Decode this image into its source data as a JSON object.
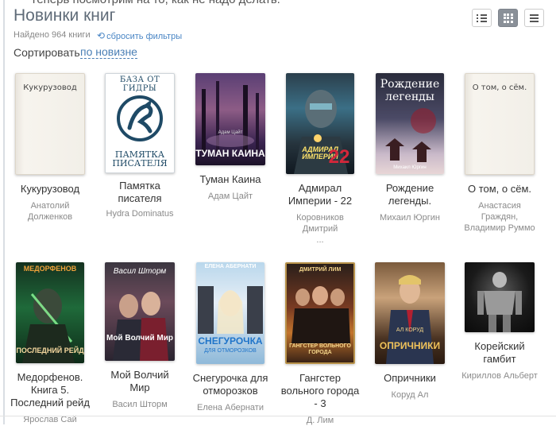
{
  "header": {
    "cut_text": "Теперь посмотрим на то, как не надо делать.",
    "title": "Новинки книг",
    "found": "Найдено 964 книги",
    "reset_filters": "сбросить фильтры",
    "sort_label": "Сортировать",
    "sort_value": "по новизне"
  },
  "view_buttons": [
    {
      "name": "list-view",
      "icon": "list-bullets-icon",
      "active": false
    },
    {
      "name": "grid-view",
      "icon": "grid-icon",
      "active": true
    },
    {
      "name": "compact-view",
      "icon": "menu-icon",
      "active": false
    }
  ],
  "books": [
    {
      "title": "Кукурузовод",
      "author": "Анатолий Долженков",
      "cover_text": "Кукурузовод"
    },
    {
      "title": "Памятка писателя",
      "author": "Hydra Dominatus",
      "cover_text": "БАЗА ОТ ГИДРЫ",
      "cover_text_2": "ПАМЯТКА ПИСАТЕЛЯ"
    },
    {
      "title": "Туман Каина",
      "author": "Адам Цайт",
      "cover_text": "ТУМАН КАИНА",
      "cover_author": "Адам Цайт"
    },
    {
      "title": "Адмирал Империи - 22",
      "author": "Коровников Дмитрий",
      "author_more": "...",
      "cover_text": "АДМИРАЛ ИМПЕРИИ",
      "cover_number": "22"
    },
    {
      "title": "Рождение легенды.",
      "author": "Михаил Юргин",
      "cover_text": "Рождение легенды",
      "cover_author": "Михаил Юргин"
    },
    {
      "title": "О том, о сём.",
      "author": "Анастасия Граждян, Владимир Руммо",
      "cover_text": "О том, о сём."
    },
    {
      "title": "Медорфенов. Книга 5. Последний рейд",
      "author": "Ярослав Сай",
      "cover_text": "МЕДОРФЕНОВ",
      "cover_text_2": "ПОСЛЕДНИЙ РЕЙД"
    },
    {
      "title": "Мой Волчий Мир",
      "author": "Васил Шторм",
      "cover_text": "Васил Шторм",
      "cover_text_2": "Мой Волчий Мир"
    },
    {
      "title": "Снегурочка для отморозков",
      "author": "Елена Абернати",
      "cover_text": "ЕЛЕНА АБЕРНАТИ",
      "cover_text_2": "СНЕГУРОЧКА",
      "cover_text_3": "ДЛЯ ОТМОРОЗКОВ"
    },
    {
      "title": "Гангстер вольного города - 3",
      "author": "Д. Лим",
      "cover_text": "ДМИТРИЙ ЛИМ",
      "cover_text_2": "ГАНГСТЕР ВОЛЬНОГО ГОРОДА"
    },
    {
      "title": "Опричники",
      "author": "Коруд Ал",
      "cover_text": "АЛ КОРУД",
      "cover_text_2": "ОПРИЧНИКИ"
    },
    {
      "title": "Корейский гамбит",
      "author": "Кириллов Альберт"
    }
  ],
  "colors": {
    "title": "#5f6b78",
    "link": "#4a86c5",
    "active_view": "#8a9098"
  }
}
